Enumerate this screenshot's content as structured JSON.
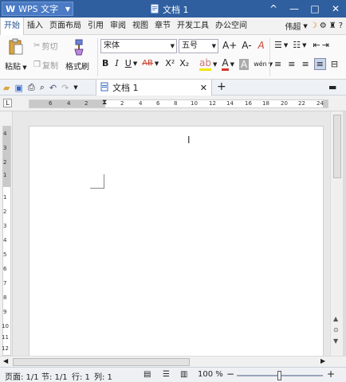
{
  "titlebar": {
    "app_name": "WPS 文字",
    "app_logo": "W",
    "doc_title": "文档 1",
    "doc_icon": "document-icon",
    "controls": [
      "^",
      "—",
      "□",
      "✕"
    ]
  },
  "menubar": {
    "items": [
      "开始",
      "插入",
      "页面布局",
      "引用",
      "审阅",
      "视图",
      "章节",
      "开发工具",
      "办公空间"
    ],
    "active": "开始",
    "right_label": "伟超"
  },
  "ribbon": {
    "paste_label": "粘贴",
    "cut_label": "剪切",
    "copy_label": "复制",
    "format_painter_label": "格式刷",
    "font_name": "宋体",
    "font_size": "五号",
    "bold": "B",
    "italic": "I",
    "underline": "U",
    "strike": "AB",
    "superscript": "X²",
    "subscript": "X₂",
    "increase_font": "A+",
    "decrease_font": "A-",
    "clear_format": "A",
    "font_color": "A",
    "char_shading": "A",
    "phonetic": "wén",
    "font_color_hex": "#d23a2a",
    "highlight_color_hex": "#f2e600"
  },
  "quickbar": {
    "tab_label": "文档 1",
    "close": "✕",
    "add": "+"
  },
  "hruler": {
    "left_numbers": [
      "6",
      "4",
      "2"
    ],
    "right_numbers": [
      "2",
      "4",
      "6",
      "8",
      "10",
      "12",
      "14",
      "16",
      "18",
      "20",
      "22",
      "24"
    ]
  },
  "vruler": {
    "numbers": [
      "4",
      "3",
      "2",
      "1",
      "1",
      "2",
      "3",
      "4",
      "5",
      "6",
      "7",
      "8",
      "9",
      "10",
      "11",
      "12"
    ]
  },
  "statusbar": {
    "page": "页面: 1/1",
    "section": "节: 1/1",
    "line": "行: 1",
    "column": "列: 1",
    "zoom": "100 %",
    "zoom_out": "−",
    "zoom_in": "+",
    "zoom_level_fraction": 0.5
  }
}
